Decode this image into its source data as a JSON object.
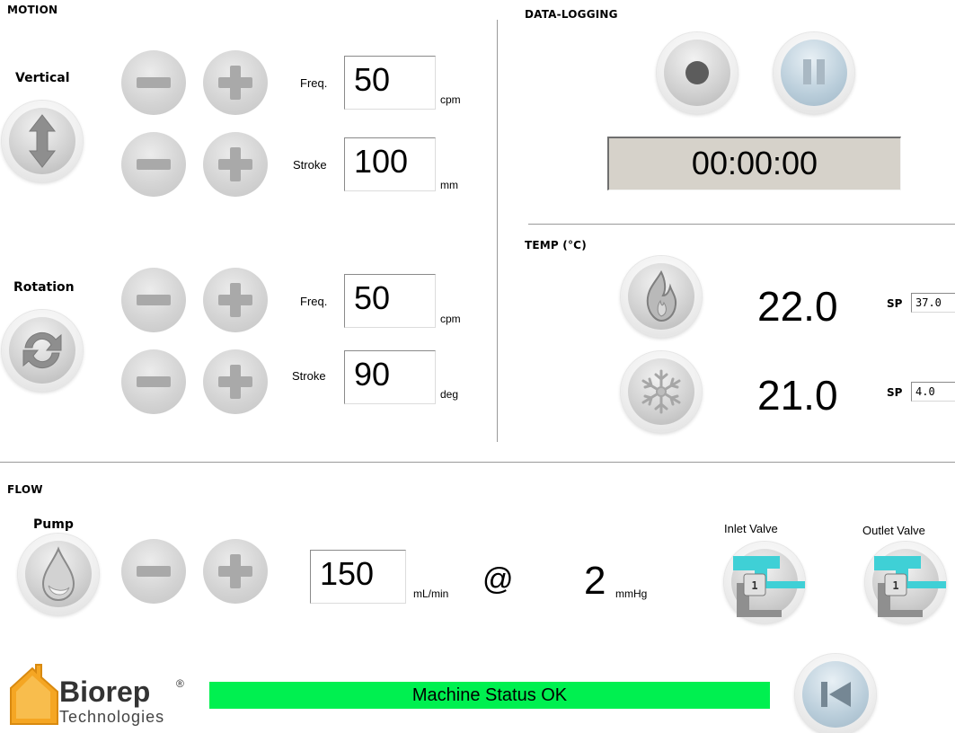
{
  "sections": {
    "motion": "MOTION",
    "data_logging": "DATA-LOGGING",
    "temp": "TEMP (°C)",
    "flow": "FLOW"
  },
  "motion": {
    "vertical": {
      "label": "Vertical",
      "icon": "vertical-arrows-icon",
      "freq_label": "Freq.",
      "freq_value": "50",
      "freq_unit": "cpm",
      "stroke_label": "Stroke",
      "stroke_value": "100",
      "stroke_unit": "mm"
    },
    "rotation": {
      "label": "Rotation",
      "icon": "rotate-arrows-icon",
      "freq_label": "Freq.",
      "freq_value": "50",
      "freq_unit": "cpm",
      "stroke_label": "Stroke",
      "stroke_value": "90",
      "stroke_unit": "deg"
    }
  },
  "data_logging": {
    "record_icon": "record-icon",
    "pause_icon": "pause-icon",
    "timer": "00:00:00"
  },
  "temp": {
    "heater": {
      "icon": "flame-icon",
      "value": "22.0",
      "sp_label": "SP",
      "sp_value": "37.0"
    },
    "cooler": {
      "icon": "snowflake-icon",
      "value": "21.0",
      "sp_label": "SP",
      "sp_value": "4.0"
    }
  },
  "flow": {
    "pump_label": "Pump",
    "pump_icon": "water-drop-icon",
    "rate_value": "150",
    "rate_unit": "mL/min",
    "at_symbol": "@",
    "pressure_value": "2",
    "pressure_unit": "mmHg",
    "inlet_label": "Inlet Valve",
    "inlet_position": "1",
    "outlet_label": "Outlet Valve",
    "outlet_position": "1"
  },
  "footer": {
    "logo_name": "Biorep",
    "logo_reg": "®",
    "logo_sub": "Technologies",
    "status": "Machine Status OK",
    "back_icon": "skip-back-icon"
  },
  "colors": {
    "status_ok": "#00f050",
    "valve_accent": "#33c6cc",
    "logo_orange": "#f5a623"
  }
}
